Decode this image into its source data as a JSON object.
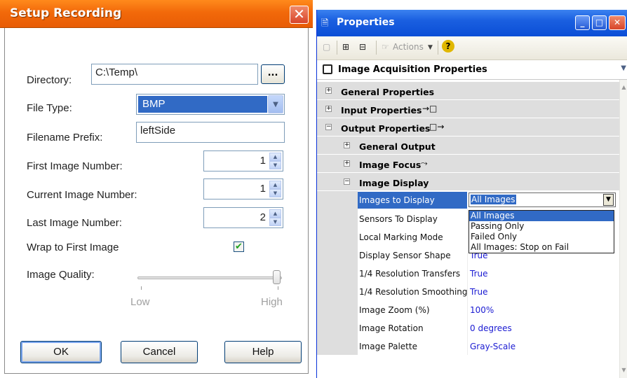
{
  "setup": {
    "title": "Setup Recording",
    "directory_label": "Directory:",
    "directory_value": "C:\\Temp\\",
    "browse_label": "...",
    "file_type_label": "File Type:",
    "file_type_value": "BMP",
    "prefix_label": "Filename Prefix:",
    "prefix_value": "leftSide",
    "first_label": "First Image Number:",
    "first_value": "1",
    "current_label": "Current Image Number:",
    "current_value": "1",
    "last_label": "Last Image Number:",
    "last_value": "2",
    "wrap_label": "Wrap to First Image",
    "wrap_checked": true,
    "quality_label": "Image Quality:",
    "quality_low": "Low",
    "quality_high": "High",
    "quality_fraction": 1.0,
    "ok_label": "OK",
    "cancel_label": "Cancel",
    "help_label": "Help",
    "accent_color": "#e85c05"
  },
  "props": {
    "title": "Properties",
    "actions_label": "Actions",
    "object_label": "Image Acquisition Properties",
    "categories": {
      "general": "General Properties",
      "input": "Input Properties",
      "output": "Output Properties",
      "general_output": "General Output",
      "image_focus": "Image Focus",
      "image_display": "Image Display"
    },
    "rows": [
      {
        "name": "Images to Display",
        "value": "All Images"
      },
      {
        "name": "Sensors To Display",
        "value": ""
      },
      {
        "name": "Local Marking Mode",
        "value": ""
      },
      {
        "name": "Display Sensor Shape",
        "value": "True"
      },
      {
        "name": "1/4 Resolution Transfers",
        "value": "True"
      },
      {
        "name": "1/4 Resolution Smoothing",
        "value": "True"
      },
      {
        "name": "Image Zoom (%)",
        "value": "100%"
      },
      {
        "name": "Image Rotation",
        "value": "0 degrees"
      },
      {
        "name": "Image Palette",
        "value": "Gray-Scale"
      }
    ],
    "dropdown_options": [
      "All Images",
      "Passing Only",
      "Failed Only",
      "All Images: Stop on Fail"
    ],
    "dropdown_selected": "All Images",
    "value_color": "#1b1bd2",
    "title_color": "#0b4ed6"
  }
}
